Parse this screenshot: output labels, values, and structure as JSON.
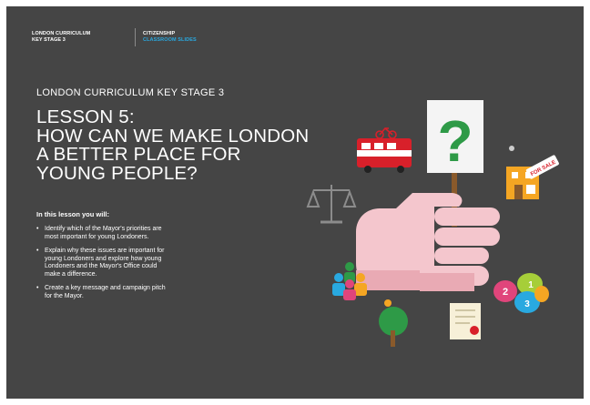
{
  "header": {
    "left_line1": "LONDON CURRICULUM",
    "left_line2": "KEY STAGE 3",
    "right_line1": "CITIZENSHIP",
    "right_line2": "CLASSROOM SLIDES"
  },
  "kicker": "LONDON CURRICULUM KEY STAGE 3",
  "title_lines": [
    "LESSON 5:",
    "HOW CAN WE MAKE LONDON",
    "A BETTER PLACE FOR",
    "YOUNG PEOPLE?"
  ],
  "intro": "In this lesson you will:",
  "bullets": [
    [
      "Identify which of the Mayor's priorities are",
      "most important for young Londoners."
    ],
    [
      "Explain why these issues are important for",
      "young Londoners and explore how young",
      "Londoners and the Mayor's Office could",
      "make a difference."
    ],
    [
      "Create a key message and campaign pitch",
      "for the Mayor."
    ]
  ],
  "illustration": {
    "sign_glyph": "?",
    "tag_text": "FOR SALE",
    "bubble_numbers": [
      "2",
      "1",
      "3"
    ],
    "colors": {
      "background": "#454545",
      "accent_blue": "#29a9e0",
      "hand": "#f4c6cd",
      "sign_green": "#2e9a47",
      "bus_red": "#d8202a"
    }
  }
}
